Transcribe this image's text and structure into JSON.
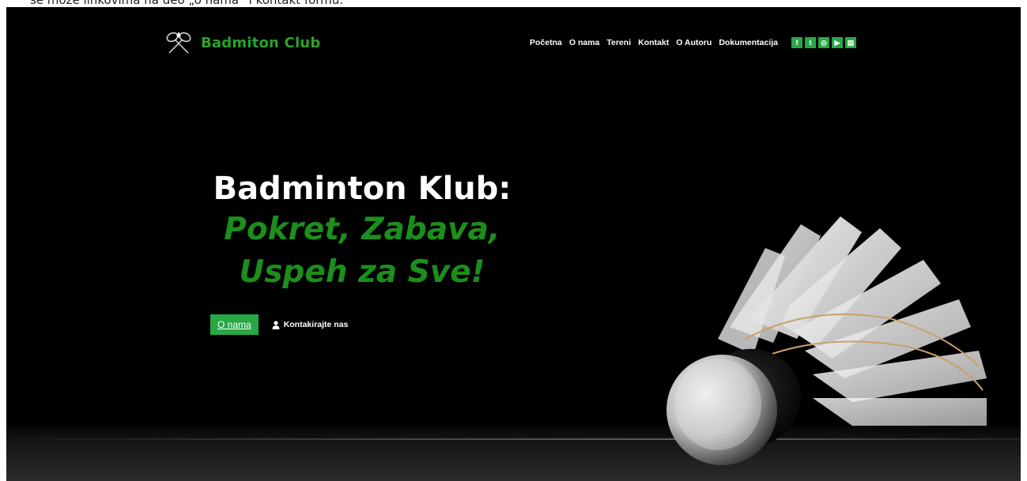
{
  "top_caption": "se može linkovima na deo „o nama“ i kontakt formu.",
  "brand": {
    "title": "Badmiton Club"
  },
  "nav": {
    "items": [
      "Početna",
      "O nama",
      "Tereni",
      "Kontakt",
      "O Autoru",
      "Dokumentacija"
    ],
    "socials": [
      "facebook-icon",
      "twitter-icon",
      "instagram-icon",
      "youtube-icon",
      "document-icon"
    ],
    "social_glyphs": [
      "f",
      "t",
      "◎",
      "▶",
      "▤"
    ]
  },
  "hero": {
    "title_line1": "Badminton Klub:",
    "title_line2": "Pokret, Zabava,",
    "title_line3": "Uspeh za Sve!",
    "primary_button": "O nama",
    "secondary_link": "Kontakirajte nas"
  },
  "colors": {
    "accent": "#28a745",
    "brand": "#29a329",
    "headline_green": "#1c8e1c",
    "background": "#000000"
  }
}
